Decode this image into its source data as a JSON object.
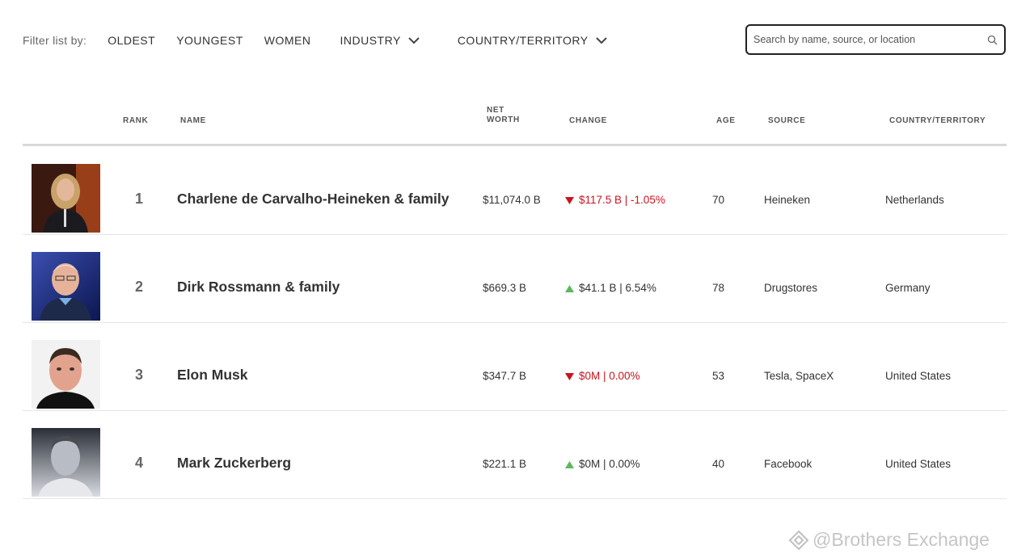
{
  "filters": {
    "label": "Filter list by:",
    "oldest": "OLDEST",
    "youngest": "YOUNGEST",
    "women": "WOMEN",
    "industry": "INDUSTRY",
    "country": "COUNTRY/TERRITORY"
  },
  "search": {
    "placeholder": "Search by name, source, or location",
    "value": ""
  },
  "columns": {
    "rank": "RANK",
    "name": "NAME",
    "net_worth_1": "NET",
    "net_worth_2": "WORTH",
    "change": "CHANGE",
    "age": "AGE",
    "source": "SOURCE",
    "country": "COUNTRY/TERRITORY"
  },
  "rows": [
    {
      "rank": "1",
      "name": "Charlene de Carvalho-Heineken & family",
      "net_worth": "$11,074.0 B",
      "change": "$117.5 B | -1.05%",
      "direction": "down",
      "age": "70",
      "source": "Heineken",
      "country": "Netherlands"
    },
    {
      "rank": "2",
      "name": "Dirk Rossmann & family",
      "net_worth": "$669.3 B",
      "change": "$41.1 B | 6.54%",
      "direction": "up",
      "age": "78",
      "source": "Drugstores",
      "country": "Germany"
    },
    {
      "rank": "3",
      "name": "Elon Musk",
      "net_worth": "$347.7 B",
      "change": "$0M | 0.00%",
      "direction": "down",
      "age": "53",
      "source": "Tesla, SpaceX",
      "country": "United States"
    },
    {
      "rank": "4",
      "name": "Mark Zuckerberg",
      "net_worth": "$221.1 B",
      "change": "$0M | 0.00%",
      "direction": "up",
      "age": "40",
      "source": "Facebook",
      "country": "United States"
    }
  ],
  "watermark": "@Brothers Exchange",
  "colors": {
    "down": "#c8141e",
    "up": "#5cb85c"
  }
}
